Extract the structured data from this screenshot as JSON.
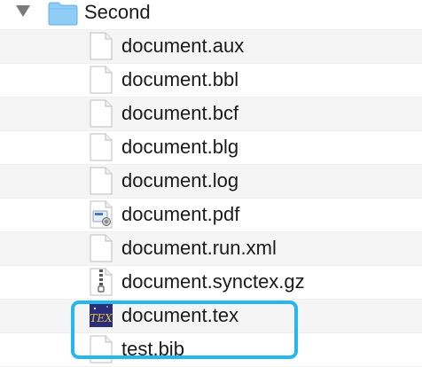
{
  "folder": {
    "name": "Second",
    "icon": "folder-icon",
    "disclosure_icon": "disclosure-triangle-expanded-icon",
    "accent_color": "#8fcdf6"
  },
  "files": [
    {
      "name": "document.aux",
      "icon": "generic-file-icon"
    },
    {
      "name": "document.bbl",
      "icon": "generic-file-icon"
    },
    {
      "name": "document.bcf",
      "icon": "generic-file-icon"
    },
    {
      "name": "document.blg",
      "icon": "generic-file-icon"
    },
    {
      "name": "document.log",
      "icon": "generic-file-icon"
    },
    {
      "name": "document.pdf",
      "icon": "pdf-preview-file-icon"
    },
    {
      "name": "document.run.xml",
      "icon": "generic-file-icon"
    },
    {
      "name": "document.synctex.gz",
      "icon": "archive-file-icon"
    },
    {
      "name": "document.tex",
      "icon": "texshop-tex-file-icon"
    },
    {
      "name": "test.bib",
      "icon": "generic-file-icon"
    }
  ],
  "highlight_color": "#27b7ef"
}
